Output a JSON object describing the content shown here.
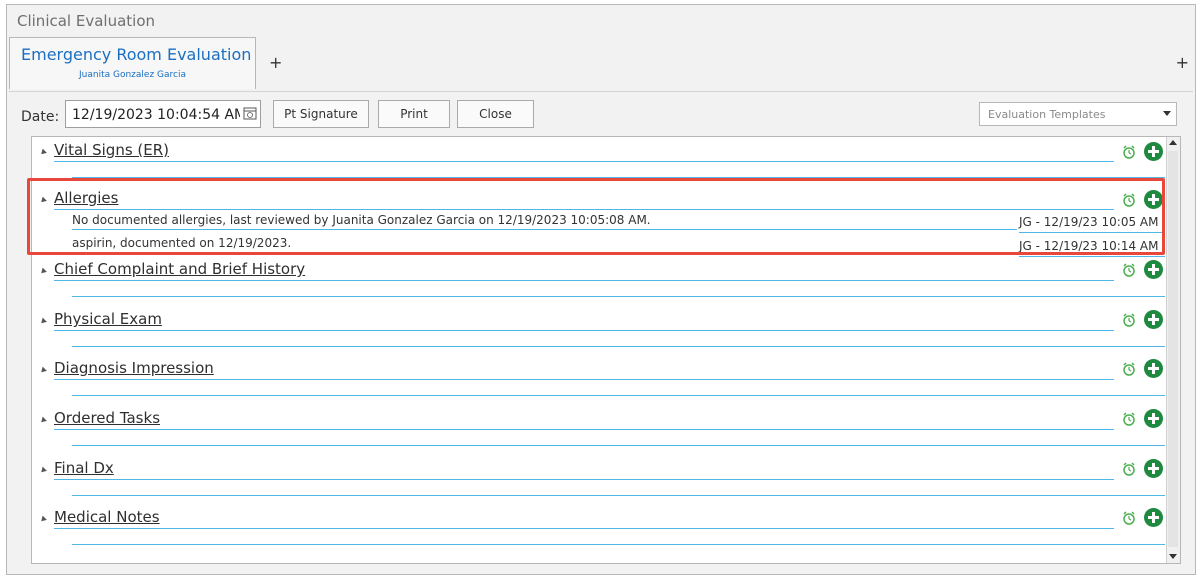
{
  "window": {
    "title": "Clinical Evaluation"
  },
  "tabs": [
    {
      "title": "Emergency Room Evaluation",
      "subtitle": "Juanita Gonzalez Garcia"
    }
  ],
  "add_tab_label": "+",
  "add_tab_right_label": "+",
  "toolbar": {
    "date_label": "Date:",
    "date_value": "12/19/2023 10:04:54 AM",
    "pt_signature_label": "Pt Signature",
    "print_label": "Print",
    "close_label": "Close",
    "templates_placeholder": "Evaluation Templates"
  },
  "sections": [
    {
      "title": "Vital Signs (ER)",
      "entries": []
    },
    {
      "title": "Allergies",
      "entries": [
        {
          "text": "No documented allergies, last reviewed by Juanita Gonzalez Garcia on 12/19/2023 10:05:08 AM.",
          "meta": "JG - 12/19/23 10:05 AM"
        },
        {
          "text": "aspirin, documented on 12/19/2023.",
          "meta": "JG - 12/19/23 10:14 AM"
        }
      ]
    },
    {
      "title": "Chief Complaint and Brief History",
      "entries": []
    },
    {
      "title": "Physical Exam",
      "entries": []
    },
    {
      "title": "Diagnosis Impression",
      "entries": []
    },
    {
      "title": "Ordered Tasks",
      "entries": []
    },
    {
      "title": "Final Dx",
      "entries": []
    },
    {
      "title": "Medical Notes",
      "entries": []
    }
  ],
  "colors": {
    "accent": "#1b6fc1",
    "line": "#4db8e8",
    "add_button": "#1e8a3f",
    "alarm": "#4caf50",
    "highlight": "#e8483b"
  }
}
